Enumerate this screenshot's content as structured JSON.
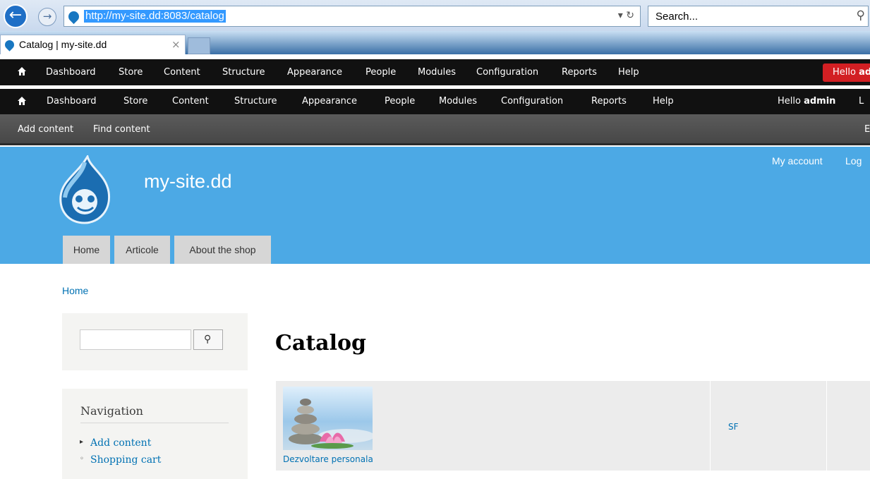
{
  "browser": {
    "url": "http://my-site.dd:8083/catalog",
    "search_placeholder": "Search...",
    "tab_title": "Catalog | my-site.dd",
    "tab_close": "×",
    "url_controls": "▾ ↻",
    "search_glyph": "⚲"
  },
  "admin_toolbar_top": {
    "items": [
      "Dashboard",
      "Store",
      "Content",
      "Structure",
      "Appearance",
      "People",
      "Modules",
      "Configuration",
      "Reports",
      "Help"
    ],
    "hello": "Hello",
    "user": "adm"
  },
  "admin_toolbar": {
    "items": [
      "Dashboard",
      "Store",
      "Content",
      "Structure",
      "Appearance",
      "People",
      "Modules",
      "Configuration",
      "Reports",
      "Help"
    ],
    "hello": "Hello",
    "user": "admin",
    "extra": "L"
  },
  "shortcuts": {
    "items": [
      "Add content",
      "Find content"
    ],
    "trailing": "E"
  },
  "site": {
    "name": "my-site.dd",
    "secondary_menu": [
      "My account",
      "Log"
    ],
    "primary_tabs": [
      "Home",
      "Articole",
      "About the shop"
    ],
    "brand_color": "#4ca9e5"
  },
  "breadcrumb": "Home",
  "sidebar": {
    "search_button_icon": "search-icon",
    "navigation_title": "Navigation",
    "navigation_items": [
      "Add content",
      "Shopping cart"
    ]
  },
  "main": {
    "title": "Catalog",
    "product_name": "Dezvoltare personala",
    "category_link": "SF"
  }
}
